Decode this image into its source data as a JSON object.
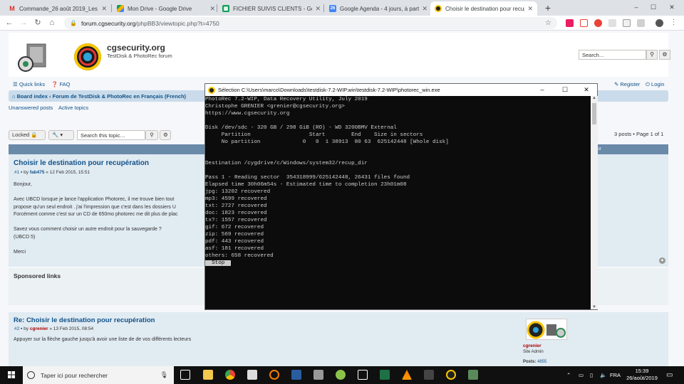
{
  "browser": {
    "tabs": [
      {
        "icon": "gmail-icon",
        "label": "Commande_26 août 2019_Les Fr...",
        "color": "#d93025"
      },
      {
        "icon": "google-drive-icon",
        "label": "Mon Drive - Google Drive",
        "color": "#1a73e8"
      },
      {
        "icon": "google-sheets-icon",
        "label": "FICHIER SUIVIS CLIENTS - Googl...",
        "color": "#0f9d58"
      },
      {
        "icon": "google-calendar-icon",
        "label": "Google Agenda - 4 jours, à partir...",
        "color": "#4285f4"
      },
      {
        "icon": "cgsecurity-icon",
        "label": "Choisir le destination pour recup...",
        "color": "#222222"
      }
    ],
    "new_tab": "+",
    "window_controls": {
      "minimize": "–",
      "maximize": "☐",
      "close": "✕"
    },
    "url_host": "forum.cgsecurity.org",
    "url_path": "/phpBB3/viewtopic.php?t=4750"
  },
  "site": {
    "name": "cgsecurity.org",
    "description": "TestDisk & PhotoRec forum",
    "search_placeholder": "Search…",
    "quick_links": "Quick links",
    "faq": "FAQ",
    "register": "Register",
    "login": "Login",
    "breadcrumb_home": "Board index",
    "breadcrumb_forum": "Forum de TestDisk & PhotoRec en Français (French)",
    "unanswered": "Unanswered posts",
    "active": "Active topics",
    "locked": "Locked",
    "topic_search_placeholder": "Search this topic…",
    "pagination": "3 posts • Page 1 of 1",
    "panel_head_right": "or"
  },
  "post1": {
    "title": "Choisir le destination pour recupération",
    "meta_num": "#1",
    "meta_by": "by",
    "author": "fab475",
    "date": "» 12 Feb 2015, 15:51",
    "lines": [
      "Bonjour,",
      "",
      "Avec UBCD lorsque je lance l'application Photorec, il me trouve bien tout",
      "propose qu'un seul endroit . j'ai l'impression que c'est dans les dossiers U",
      "Forcément comme c'est sur un CD de 650mo photorec me dit plus de plac",
      "",
      "Savez vous comment choisir un autre endroit pour la sauvegarde ?",
      "(UBCD 5)",
      "",
      "Merci"
    ]
  },
  "sponsored": "Sponsored links",
  "post2": {
    "title": "Re: Choisir le destination pour recupération",
    "meta_num": "#2",
    "meta_by": "by",
    "author": "cgrenier",
    "date": "» 13 Feb 2015, 08:54",
    "text": "Appuyer sur la flèche gauche jusqu'à avoir une liste de de vos différents lecteurs",
    "profile_name": "cgrenier",
    "profile_rank": "Site Admin",
    "profile_posts_label": "Posts:",
    "profile_posts": "4855"
  },
  "console_window": {
    "title": "Sélection C:\\Users\\marco\\Downloads\\testdisk-7.2-WIP.win\\testdisk-7.2-WIP\\photorec_win.exe",
    "lines": [
      "PhotoRec 7.2-WIP, Data Recovery Utility, July 2019",
      "Christophe GRENIER <grenier@cgsecurity.org>",
      "https://www.cgsecurity.org",
      "",
      "Disk /dev/sdc - 320 GB / 298 GiB (RO) - WD 3200BMV External",
      "     Partition                  Start        End    Size in sectors",
      "     No partition             0   0  1 38913  80 63  625142448 [Whole disk]",
      "",
      "",
      "Destination /cygdrive/c/Windows/system32/recup_dir",
      "",
      "Pass 1 - Reading sector  354318999/625142448, 26431 files found",
      "Elapsed time 30h06m54s - Estimated time to completion 23h01m08",
      "jpg: 13202 recovered",
      "mp3: 4599 recovered",
      "txt: 2727 recovered",
      "doc: 1823 recovered",
      "tx?: 1557 recovered",
      "gif: 672 recovered",
      "zip: 569 recovered",
      "pdf: 443 recovered",
      "asf: 181 recovered",
      "others: 658 recovered"
    ],
    "stop_button": "  Stop  "
  },
  "taskbar": {
    "search_placeholder": "Taper ici pour rechercher",
    "lang": "FRA",
    "time": "15:39",
    "date": "26/août/2019"
  }
}
